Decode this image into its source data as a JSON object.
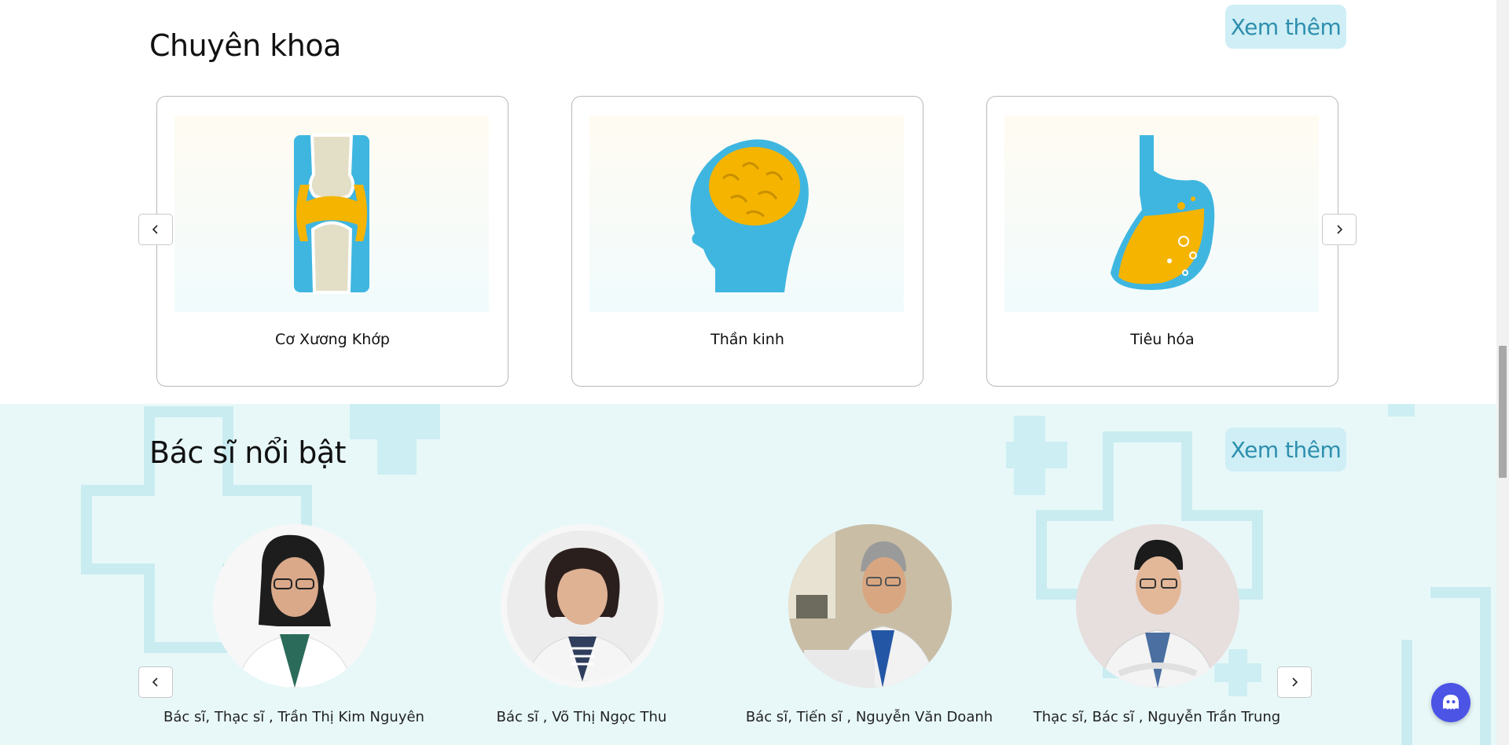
{
  "specialty": {
    "title": "Chuyên khoa",
    "more_label": "Xem thêm",
    "items": [
      {
        "label": "Cơ Xương Khớp",
        "icon": "joint-icon"
      },
      {
        "label": "Thần kinh",
        "icon": "brain-icon"
      },
      {
        "label": "Tiêu hóa",
        "icon": "stomach-icon"
      }
    ]
  },
  "doctors": {
    "title": "Bác sĩ nổi bật",
    "more_label": "Xem thêm",
    "items": [
      {
        "name": "Bác sĩ, Thạc sĩ , Trần Thị Kim Nguyên"
      },
      {
        "name": "Bác sĩ , Võ Thị Ngọc Thu"
      },
      {
        "name": "Bác sĩ, Tiến sĩ , Nguyễn Văn Doanh"
      },
      {
        "name": "Thạc sĩ, Bác sĩ , Nguyễn Trần Trung"
      }
    ]
  },
  "colors": {
    "accent": "#2d8fae",
    "button_bg": "#cfeef5",
    "doctors_bg": "#e8f8f9",
    "chat": "#4b54e5"
  }
}
